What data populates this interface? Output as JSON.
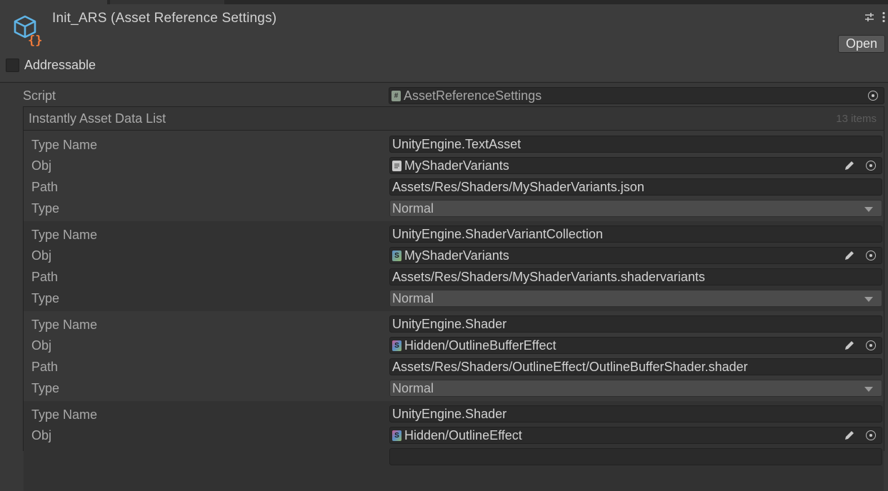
{
  "asset_title": "Init_ARS (Asset Reference Settings)",
  "open_button": "Open",
  "addressable_label": "Addressable",
  "script": {
    "label": "Script",
    "value": "AssetReferenceSettings"
  },
  "list": {
    "title": "Instantly Asset Data List",
    "count": "13 items",
    "field_labels": {
      "type_name": "Type Name",
      "obj": "Obj",
      "path": "Path",
      "type": "Type"
    },
    "elements": [
      {
        "type_name": "UnityEngine.TextAsset",
        "obj": "MyShaderVariants",
        "obj_icon": "text-asset-icon",
        "path": "Assets/Res/Shaders/MyShaderVariants.json",
        "type": "Normal"
      },
      {
        "type_name": "UnityEngine.ShaderVariantCollection",
        "obj": "MyShaderVariants",
        "obj_icon": "shader-variant-collection-icon",
        "path": "Assets/Res/Shaders/MyShaderVariants.shadervariants",
        "type": "Normal"
      },
      {
        "type_name": "UnityEngine.Shader",
        "obj": "Hidden/OutlineBufferEffect",
        "obj_icon": "shader-icon",
        "path": "Assets/Res/Shaders/OutlineEffect/OutlineBufferShader.shader",
        "type": "Normal"
      },
      {
        "type_name": "UnityEngine.Shader",
        "obj": "Hidden/OutlineEffect",
        "obj_icon": "shader-icon"
      }
    ]
  },
  "colors": {
    "background": "#383838",
    "field": "#2a2a2a",
    "accent_icon_blue": "#5fb4e6",
    "accent_icon_orange": "#f07a3a"
  }
}
